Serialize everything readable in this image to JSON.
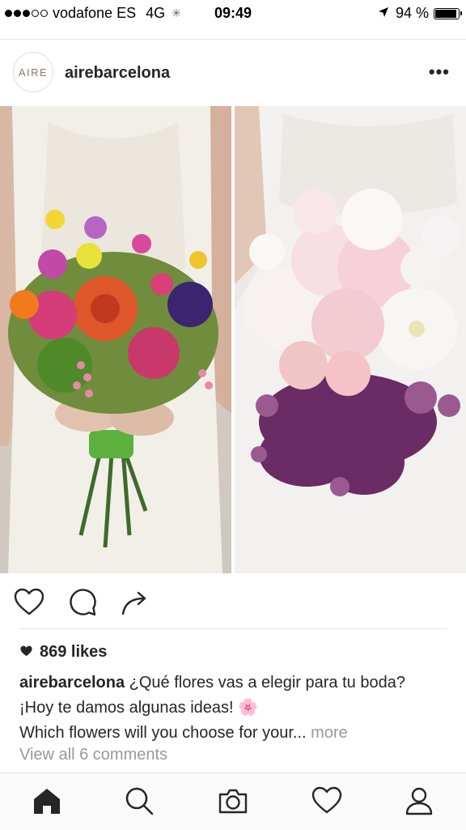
{
  "status_bar": {
    "carrier": "vodafone ES",
    "network": "4G",
    "time": "09:49",
    "battery": "94 %",
    "battery_level": 0.94,
    "signal_bars": 3,
    "icons": [
      "signal-dots-icon",
      "loading-spinner-icon",
      "location-arrow-icon",
      "battery-icon"
    ]
  },
  "post": {
    "avatar_text": "AIRE",
    "username": "airebarcelona",
    "options_label": "•••",
    "likes": "869 likes",
    "caption_user": "airebarcelona",
    "caption_line1": "¿Qué flores vas a elegir para tu boda?",
    "caption_line2": "¡Hoy te damos algunas ideas! 🌸",
    "caption_line3": "Which flowers will you choose for your...",
    "more_label": "more",
    "view_comments": "View all 6 comments"
  },
  "actions": [
    "heart-outline-icon",
    "comment-icon",
    "share-icon"
  ],
  "tabbar": [
    "home-icon",
    "search-icon",
    "camera-icon",
    "heart-icon",
    "profile-icon"
  ],
  "colors": {
    "text": "#262626",
    "muted": "#999999",
    "divider": "#e5e5e5",
    "tabbar_bg": "#fafafa"
  }
}
